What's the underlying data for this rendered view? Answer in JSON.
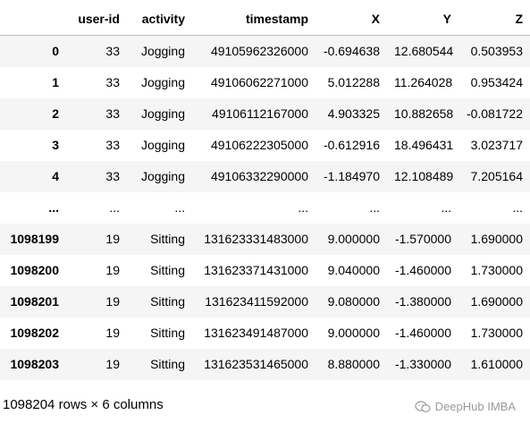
{
  "table": {
    "columns": [
      "",
      "user-id",
      "activity",
      "timestamp",
      "X",
      "Y",
      "Z"
    ],
    "rows": [
      {
        "index": "0",
        "cells": [
          "33",
          "Jogging",
          "49105962326000",
          "-0.694638",
          "12.680544",
          "0.503953"
        ]
      },
      {
        "index": "1",
        "cells": [
          "33",
          "Jogging",
          "49106062271000",
          "5.012288",
          "11.264028",
          "0.953424"
        ]
      },
      {
        "index": "2",
        "cells": [
          "33",
          "Jogging",
          "49106112167000",
          "4.903325",
          "10.882658",
          "-0.081722"
        ]
      },
      {
        "index": "3",
        "cells": [
          "33",
          "Jogging",
          "49106222305000",
          "-0.612916",
          "18.496431",
          "3.023717"
        ]
      },
      {
        "index": "4",
        "cells": [
          "33",
          "Jogging",
          "49106332290000",
          "-1.184970",
          "12.108489",
          "7.205164"
        ]
      },
      {
        "index": "...",
        "cells": [
          "...",
          "...",
          "...",
          "...",
          "...",
          "..."
        ]
      },
      {
        "index": "1098199",
        "cells": [
          "19",
          "Sitting",
          "131623331483000",
          "9.000000",
          "-1.570000",
          "1.690000"
        ]
      },
      {
        "index": "1098200",
        "cells": [
          "19",
          "Sitting",
          "131623371431000",
          "9.040000",
          "-1.460000",
          "1.730000"
        ]
      },
      {
        "index": "1098201",
        "cells": [
          "19",
          "Sitting",
          "131623411592000",
          "9.080000",
          "-1.380000",
          "1.690000"
        ]
      },
      {
        "index": "1098202",
        "cells": [
          "19",
          "Sitting",
          "131623491487000",
          "9.000000",
          "-1.460000",
          "1.730000"
        ]
      },
      {
        "index": "1098203",
        "cells": [
          "19",
          "Sitting",
          "131623531465000",
          "8.880000",
          "-1.330000",
          "1.610000"
        ]
      }
    ]
  },
  "shape_text": "1098204 rows × 6 columns",
  "watermark": {
    "text": "DeepHub IMBA",
    "icon": "wechat-icon"
  },
  "colors": {
    "stripe": "#f5f5f5",
    "header_border": "#bdbdbd",
    "watermark": "#9a9a9a"
  }
}
